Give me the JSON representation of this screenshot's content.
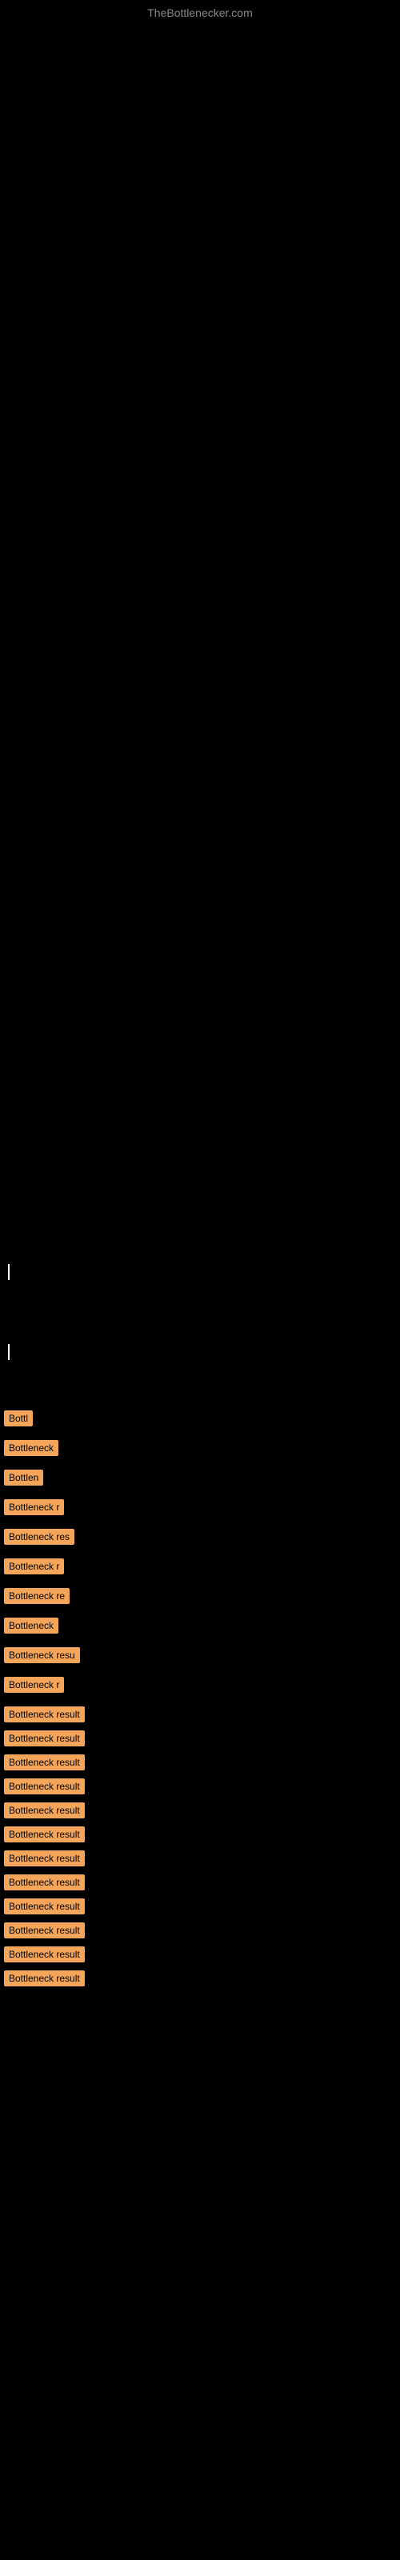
{
  "site": {
    "title": "TheBottlenecker.com"
  },
  "items": [
    {
      "id": 1,
      "label": "Bottl",
      "width_class": "w1"
    },
    {
      "id": 2,
      "label": "Bottleneck",
      "width_class": "w2"
    },
    {
      "id": 3,
      "label": "Bottlen",
      "width_class": "w3"
    },
    {
      "id": 4,
      "label": "Bottleneck r",
      "width_class": "w4"
    },
    {
      "id": 5,
      "label": "Bottleneck res",
      "width_class": "w5"
    },
    {
      "id": 6,
      "label": "Bottleneck r",
      "width_class": "w6"
    },
    {
      "id": 7,
      "label": "Bottleneck re",
      "width_class": "w7"
    },
    {
      "id": 8,
      "label": "Bottleneck",
      "width_class": "w8"
    },
    {
      "id": 9,
      "label": "Bottleneck resu",
      "width_class": "w9"
    },
    {
      "id": 10,
      "label": "Bottleneck r",
      "width_class": "w10"
    },
    {
      "id": 11,
      "label": "Bottleneck result",
      "width_class": "w11"
    },
    {
      "id": 12,
      "label": "Bottleneck result",
      "width_class": "w12"
    },
    {
      "id": 13,
      "label": "Bottleneck result",
      "width_class": "w13"
    },
    {
      "id": 14,
      "label": "Bottleneck result",
      "width_class": "w14"
    },
    {
      "id": 15,
      "label": "Bottleneck result",
      "width_class": "w15"
    },
    {
      "id": 16,
      "label": "Bottleneck result",
      "width_class": "w16"
    },
    {
      "id": 17,
      "label": "Bottleneck result",
      "width_class": "w17"
    },
    {
      "id": 18,
      "label": "Bottleneck result",
      "width_class": "w18"
    },
    {
      "id": 19,
      "label": "Bottleneck result",
      "width_class": "w19"
    },
    {
      "id": 20,
      "label": "Bottleneck result",
      "width_class": "w20"
    },
    {
      "id": 21,
      "label": "Bottleneck result",
      "width_class": "w21"
    },
    {
      "id": 22,
      "label": "Bottleneck result",
      "width_class": "w22"
    }
  ]
}
